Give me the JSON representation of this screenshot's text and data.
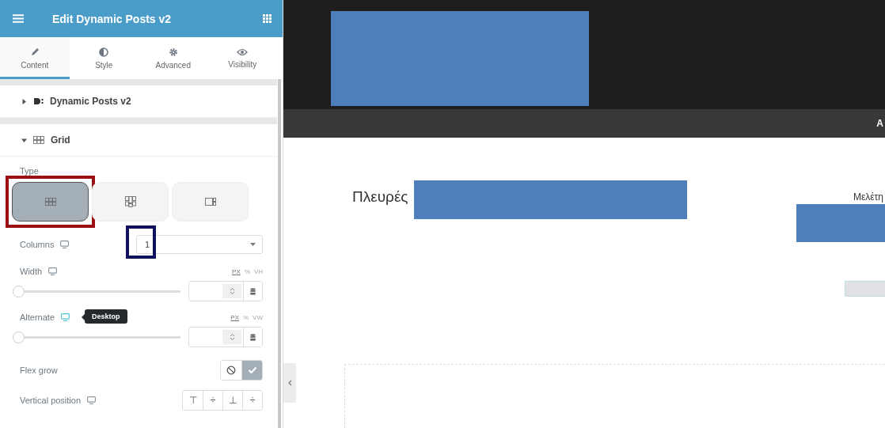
{
  "panel": {
    "title": "Edit Dynamic Posts v2",
    "tabs": [
      {
        "label": "Content",
        "selected": true
      },
      {
        "label": "Style",
        "selected": false
      },
      {
        "label": "Advanced",
        "selected": false
      },
      {
        "label": "Visibility",
        "selected": false
      }
    ],
    "sections": [
      {
        "title": "Dynamic Posts v2",
        "expanded": false
      },
      {
        "title": "Grid",
        "expanded": true
      }
    ],
    "controls": [
      {
        "kind": "choice",
        "label": "Type",
        "options": [
          {
            "selected": true
          },
          {
            "selected": false
          },
          {
            "selected": false
          }
        ]
      },
      {
        "kind": "select",
        "label": "Columns",
        "value": "1"
      },
      {
        "kind": "slider",
        "label": "Width",
        "level": 0,
        "units": [
          {
            "label": "PX",
            "selected": true
          },
          {
            "label": "%",
            "selected": false
          },
          {
            "label": "VH",
            "selected": false
          }
        ]
      },
      {
        "kind": "slider",
        "label": "Alternate",
        "level": 0,
        "tooltip": "Desktop",
        "units": [
          {
            "label": "PX",
            "selected": true
          },
          {
            "label": "%",
            "selected": false
          },
          {
            "label": "VW",
            "selected": false
          }
        ]
      },
      {
        "kind": "toggle",
        "label": "Flex grow",
        "options": [
          {
            "selected": false
          },
          {
            "selected": true
          }
        ]
      },
      {
        "kind": "buttons",
        "label": "Vertical position",
        "options": [
          {
            "glyph": "⊤",
            "selected": false
          },
          {
            "glyph": "÷",
            "selected": false
          },
          {
            "glyph": "⊥",
            "selected": false
          },
          {
            "glyph": "÷",
            "selected": false
          }
        ]
      }
    ]
  },
  "preview": {
    "nav_text": "A",
    "heading": "Πλευρές",
    "side_text": "Μελέτη"
  }
}
